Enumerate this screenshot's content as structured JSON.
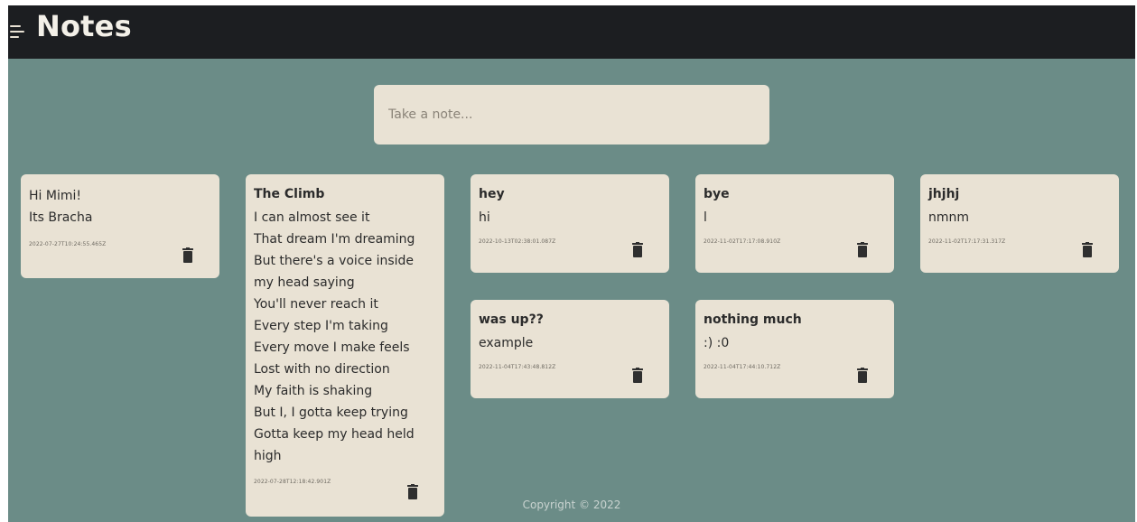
{
  "header": {
    "title": "Notes",
    "menu_icon": "hamburger-menu-icon"
  },
  "input": {
    "placeholder": "Take a note..."
  },
  "notes": [
    {
      "title": "Hi Mimi!",
      "content": "Its Bracha",
      "time": "2022-07-27T10:24:55.465Z"
    },
    {
      "title": "The Climb",
      "content": "I can almost see it\nThat dream I'm dreaming\nBut there's a voice inside\nmy head saying\nYou'll never reach it\nEvery step I'm taking\nEvery move I make feels\nLost with no direction\nMy faith is shaking\nBut I, I gotta keep trying\nGotta keep my head held\nhigh",
      "time": "2022-07-28T12:18:42.901Z"
    },
    {
      "title": "hey",
      "content": "hi",
      "time": "2022-10-13T02:38:01.087Z"
    },
    {
      "title": "bye",
      "content": "l",
      "time": "2022-11-02T17:17:08.910Z"
    },
    {
      "title": "jhjhj",
      "content": "nmnm",
      "time": "2022-11-02T17:17:31.317Z"
    },
    {
      "title": "was up??",
      "content": "example",
      "time": "2022-11-04T17:43:48.812Z"
    },
    {
      "title": "nothing much",
      "content": ":) :0",
      "time": "2022-11-04T17:44:10.712Z"
    }
  ],
  "icons": {
    "delete": "trash-icon"
  },
  "footer": {
    "copyright": "Copyright © 2022"
  },
  "colors": {
    "background": "#6b8c87",
    "header": "#1c1e21",
    "note": "#e9e2d4"
  }
}
